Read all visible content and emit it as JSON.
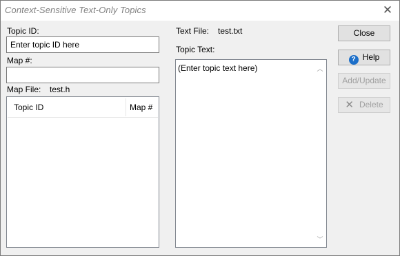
{
  "window": {
    "title": "Context-Sensitive Text-Only Topics",
    "close_glyph": "✕"
  },
  "topic_id": {
    "label": "Topic ID:",
    "value": "Enter topic ID here"
  },
  "map_number": {
    "label": "Map #:",
    "value": ""
  },
  "map_file": {
    "label": "Map File:",
    "value": "test.h"
  },
  "topic_list": {
    "columns": [
      "Topic ID",
      "Map #"
    ],
    "rows": []
  },
  "text_file": {
    "label": "Text File:",
    "value": "test.txt"
  },
  "topic_text": {
    "label": "Topic Text:",
    "value": "(Enter topic text here)"
  },
  "buttons": {
    "close": "Close",
    "help": "Help",
    "help_icon_glyph": "?",
    "add_update": "Add/Update",
    "delete": "Delete",
    "delete_icon_glyph": "✕"
  },
  "icons": {
    "help": "help-icon",
    "delete": "delete-x-icon",
    "close": "close-icon"
  }
}
